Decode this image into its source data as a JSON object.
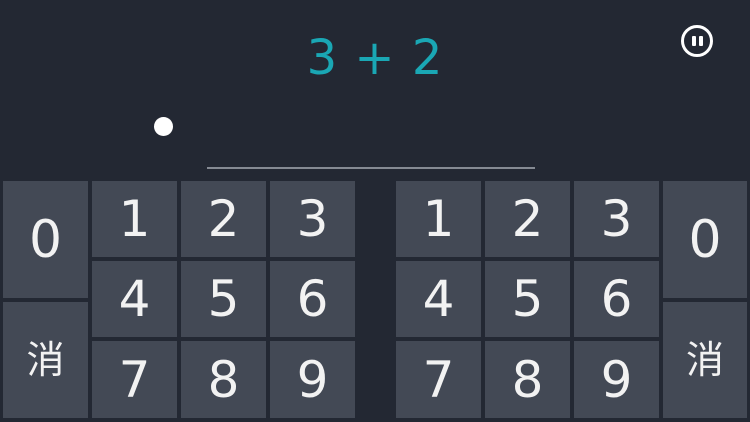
{
  "question": {
    "text": "3 + 2"
  },
  "answer": {
    "value": ""
  },
  "icons": {
    "pause": "pause-icon"
  },
  "colors": {
    "background": "#232833",
    "key": "#434955",
    "equation": "#1aa7b4",
    "key_text": "#f2f2f2"
  },
  "keypad_left": {
    "zero": "0",
    "erase": "消",
    "digits": [
      "1",
      "2",
      "3",
      "4",
      "5",
      "6",
      "7",
      "8",
      "9"
    ]
  },
  "keypad_right": {
    "zero": "0",
    "erase": "消",
    "digits": [
      "1",
      "2",
      "3",
      "4",
      "5",
      "6",
      "7",
      "8",
      "9"
    ]
  }
}
